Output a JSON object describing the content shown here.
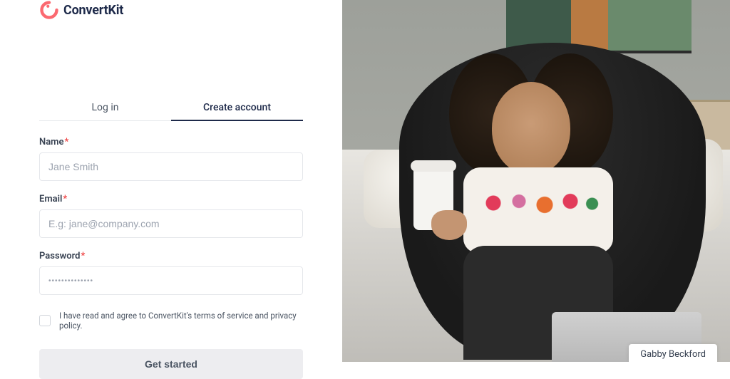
{
  "brand": {
    "name": "ConvertKit"
  },
  "tabs": {
    "login": {
      "label": "Log in",
      "active": false
    },
    "create": {
      "label": "Create account",
      "active": true
    }
  },
  "form": {
    "name": {
      "label": "Name",
      "placeholder": "Jane Smith"
    },
    "email": {
      "label": "Email",
      "placeholder": "E.g: jane@company.com"
    },
    "password": {
      "label": "Password",
      "placeholder": "••••••••••••••"
    },
    "terms": {
      "label": "I have read and agree to ConvertKit's terms of service and privacy policy."
    },
    "submit": {
      "label": "Get started"
    }
  },
  "hero": {
    "attribution": "Gabby Beckford"
  },
  "required_marker": "*"
}
